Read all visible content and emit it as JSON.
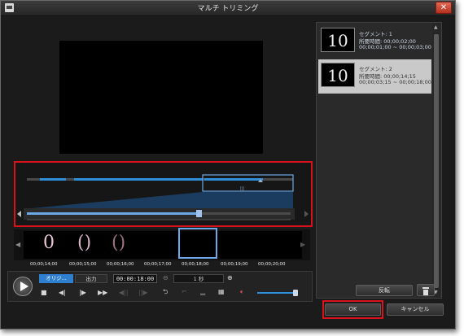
{
  "window": {
    "title": "マルチ トリミング",
    "close_glyph": "✕"
  },
  "segments": [
    {
      "thumb_text": "10",
      "name": "セグメント: 1",
      "duration_line": "所要時間: 00;00;02;00",
      "range_line": "00;00;01;00 ~ 00;00;03;00"
    },
    {
      "thumb_text": "10",
      "name": "セグメント: 2",
      "duration_line": "所要時間: 00;00;14;15",
      "range_line": "00;00;03;15 ~ 00;00;18;00"
    }
  ],
  "panel": {
    "reverse_label": "反転",
    "delete_icon": "trash-icon"
  },
  "timeline": {
    "ticks": [
      "00;00;14;00",
      "00;00;15;00",
      "00;00;16;00",
      "00;00;17;00",
      "00;00;18;00",
      "00;00;19;00",
      "00;00;20;00"
    ],
    "thumbnail_chars": [
      "0",
      "()",
      "()"
    ]
  },
  "controls": {
    "tab_original": "オリジ...",
    "tab_output": "出力",
    "timecode": "00:00:18:00",
    "zoom_value": "1 秒",
    "play_icon": "play-icon"
  },
  "buttons": {
    "ok": "OK",
    "cancel": "キャンセル"
  },
  "colors": {
    "accent": "#2f8fd8",
    "highlight_box": "#d8121c",
    "selection": "#6aa8e8"
  }
}
